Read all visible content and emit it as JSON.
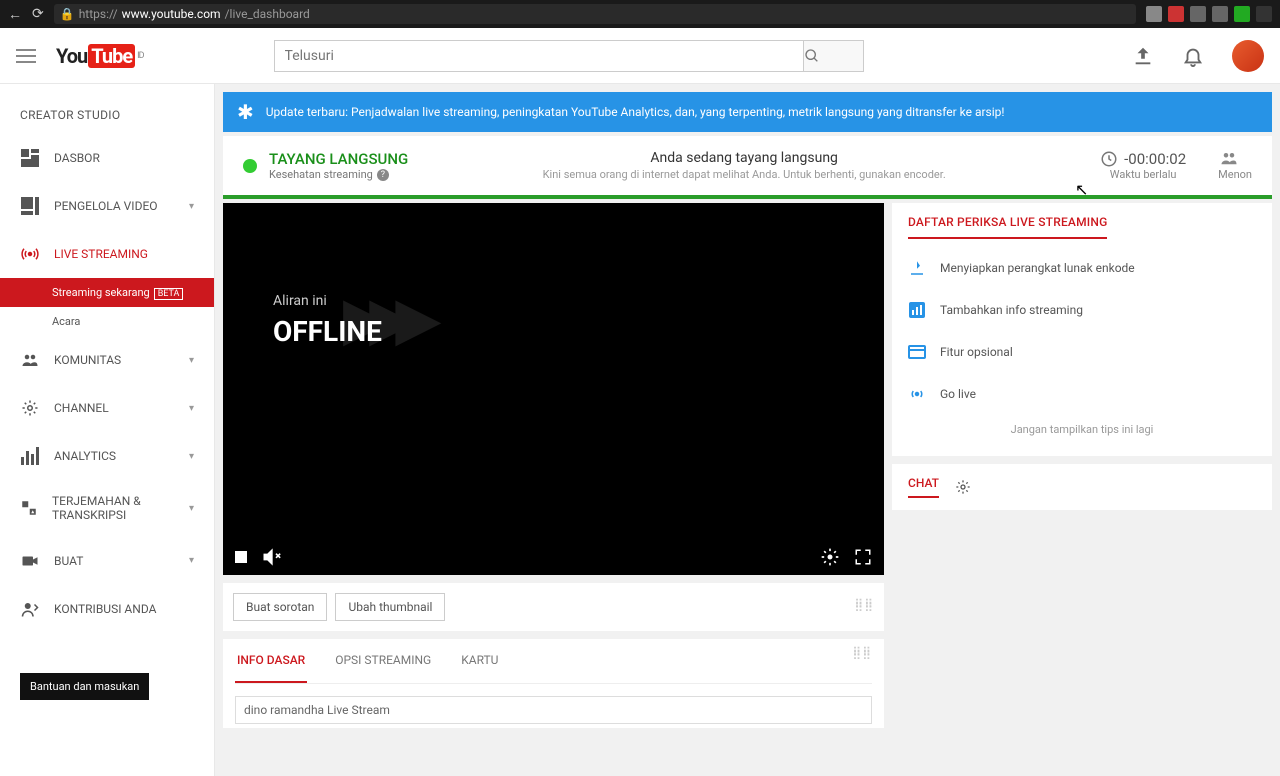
{
  "browser": {
    "url_proto": "https://",
    "url_domain": "www.youtube.com",
    "url_path": "/live_dashboard"
  },
  "logo": {
    "you": "You",
    "tube": "Tube",
    "sup": "ID"
  },
  "search": {
    "placeholder": "Telusuri"
  },
  "sidebar": {
    "title": "CREATOR STUDIO",
    "items": [
      {
        "icon": "dashboard",
        "label": "DASBOR"
      },
      {
        "icon": "video",
        "label": "PENGELOLA VIDEO",
        "chev": true
      },
      {
        "icon": "live",
        "label": "LIVE STREAMING",
        "live": true
      },
      {
        "icon": "community",
        "label": "KOMUNITAS",
        "chev": true
      },
      {
        "icon": "channel",
        "label": "CHANNEL",
        "chev": true
      },
      {
        "icon": "analytics",
        "label": "ANALYTICS",
        "chev": true
      },
      {
        "icon": "translate",
        "label": "TERJEMAHAN & TRANSKRIPSI",
        "chev": true
      },
      {
        "icon": "create",
        "label": "BUAT",
        "chev": true
      },
      {
        "icon": "contrib",
        "label": "KONTRIBUSI ANDA"
      }
    ],
    "sub": [
      {
        "label": "Streaming sekarang",
        "beta": "BETA",
        "active": true
      },
      {
        "label": "Acara"
      }
    ],
    "help": "Bantuan dan masukan"
  },
  "banner": "Update terbaru: Penjadwalan live streaming, peningkatan YouTube Analytics, dan, yang terpenting, metrik langsung yang ditransfer ke arsip!",
  "status": {
    "live_label": "TAYANG LANGSUNG",
    "health": "Kesehatan streaming",
    "mid_h": "Anda sedang tayang langsung",
    "mid_s": "Kini semua orang di internet dapat melihat Anda. Untuk berhenti, gunakan encoder.",
    "time": "-00:00:02",
    "time_s": "Waktu berlalu",
    "view_s": "Menon"
  },
  "player": {
    "a": "Aliran ini",
    "b": "OFFLINE"
  },
  "buttons": {
    "highlight": "Buat sorotan",
    "thumb": "Ubah thumbnail"
  },
  "tabs": [
    "INFO DASAR",
    "OPSI STREAMING",
    "KARTU"
  ],
  "stream_title": "dino ramandha Live Stream",
  "checklist": {
    "title": "DAFTAR PERIKSA LIVE STREAMING",
    "items": [
      {
        "icon": "download",
        "label": "Menyiapkan perangkat lunak enkode"
      },
      {
        "icon": "info",
        "label": "Tambahkan info streaming"
      },
      {
        "icon": "card",
        "label": "Fitur opsional"
      },
      {
        "icon": "broadcast",
        "label": "Go live"
      }
    ],
    "tips": "Jangan tampilkan tips ini lagi"
  },
  "chat": {
    "title": "CHAT"
  }
}
